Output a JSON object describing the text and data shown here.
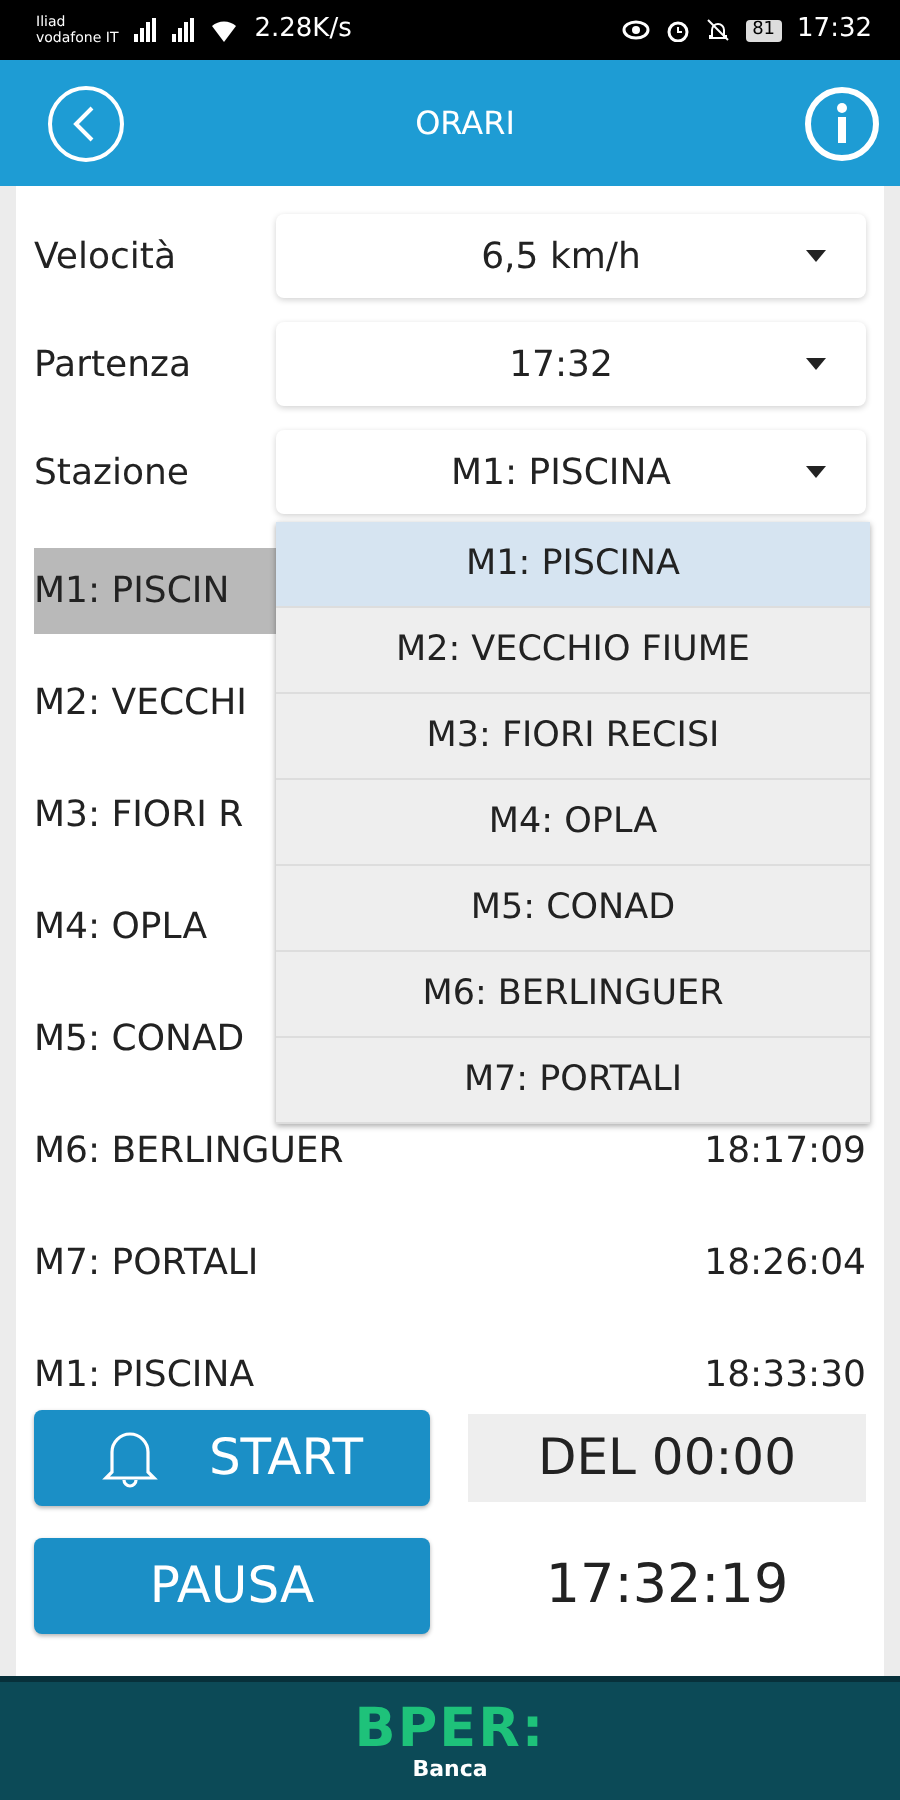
{
  "status_bar": {
    "carrier_1": "Iliad",
    "carrier_2": "vodafone IT",
    "speed": "2.28K/s",
    "battery": "81",
    "time": "17:32"
  },
  "header": {
    "title": "ORARI"
  },
  "fields": [
    {
      "label": "Velocità",
      "value": "6,5 km/h"
    },
    {
      "label": "Partenza",
      "value": "17:32"
    },
    {
      "label": "Stazione",
      "value": "M1: PISCINA"
    }
  ],
  "schedule": [
    {
      "station": "M1: PISCIN",
      "selected": true
    },
    {
      "station": "M2: VECCHI",
      "selected": false
    },
    {
      "station": "M3: FIORI R",
      "selected": false
    },
    {
      "station": "M4: OPLA",
      "selected": false
    },
    {
      "station": "M5: CONAD",
      "selected": false
    },
    {
      "station": "M6: BERLINGUER",
      "time": "18:17:09",
      "selected": false
    },
    {
      "station": "M7: PORTALI",
      "time": "18:26:04",
      "selected": false
    },
    {
      "station": "M1: PISCINA",
      "time": "18:33:30",
      "selected": false
    }
  ],
  "dropdown": {
    "options": [
      {
        "label": "M1: PISCINA",
        "selected": true
      },
      {
        "label": "M2: VECCHIO FIUME",
        "selected": false
      },
      {
        "label": "M3: FIORI RECISI",
        "selected": false
      },
      {
        "label": "M4: OPLA",
        "selected": false
      },
      {
        "label": "M5: CONAD",
        "selected": false
      },
      {
        "label": "M6: BERLINGUER",
        "selected": false
      },
      {
        "label": "M7: PORTALI",
        "selected": false
      }
    ]
  },
  "start_button": "START",
  "pause_button": "PAUSA",
  "delay": "DEL 00:00",
  "clock": "17:32:19",
  "footer": {
    "logo": "BPER:",
    "subtitle": "Banca"
  }
}
